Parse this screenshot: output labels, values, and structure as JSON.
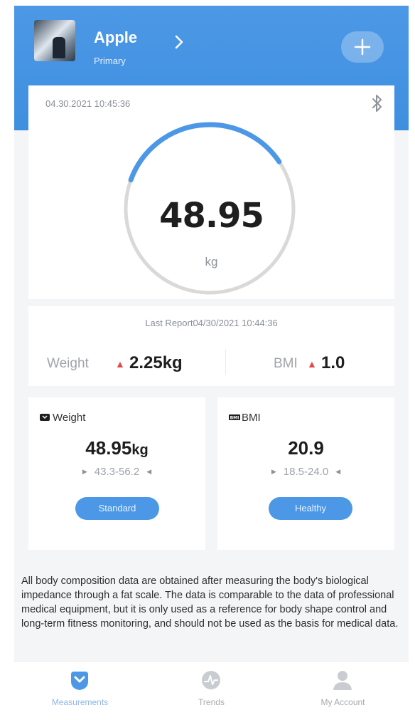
{
  "header": {
    "user_name": "Apple",
    "user_role": "Primary",
    "add_label": "+"
  },
  "measurement": {
    "timestamp": "04.30.2021 10:45:36",
    "weight": "48.95",
    "unit": "kg",
    "gauge_progress_percent": 35
  },
  "report": {
    "last_report": "Last Report04/30/2021 10:44:36",
    "weight_label": "Weight",
    "weight_delta": "2.25kg",
    "bmi_label": "BMI",
    "bmi_delta": "1.0"
  },
  "metrics": {
    "weight": {
      "title": "Weight",
      "value": "48.95",
      "unit": "kg",
      "range": "43.3-56.2",
      "status": "Standard"
    },
    "bmi": {
      "title": "BMI",
      "value": "20.9",
      "range": "18.5-24.0",
      "status": "Healthy"
    }
  },
  "disclaimer": "All body composition data are obtained after measuring the body's biological impedance through a fat scale. The data is comparable to the data of professional medical equipment, but it is only used as a reference for body shape control and long-term fitness monitoring, and should not be used as the basis for medical data.",
  "tabs": [
    {
      "label": "Measurements",
      "icon": "scale-icon",
      "active": true
    },
    {
      "label": "Trends",
      "icon": "trends-icon",
      "active": false
    },
    {
      "label": "My Account",
      "icon": "person-icon",
      "active": false
    }
  ],
  "colors": {
    "accent": "#4c98e6",
    "delta_up": "#e54848",
    "gauge_track": "#d9d9d9"
  }
}
